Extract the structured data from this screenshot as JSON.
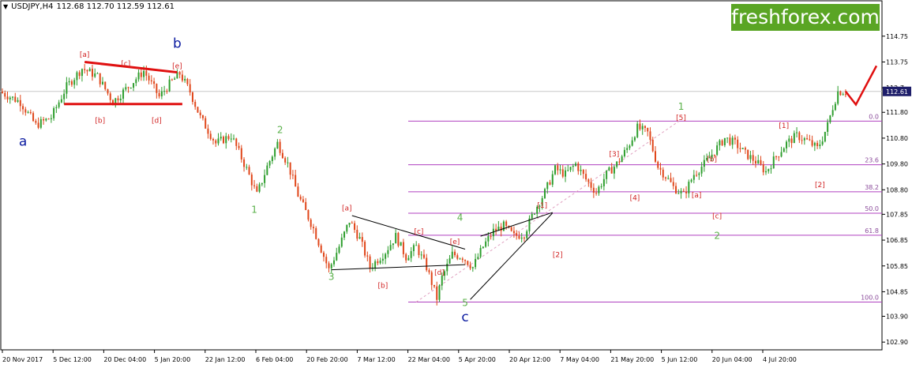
{
  "header": {
    "symbol_timeframe": "USDJPY,H4",
    "ohlc": "112.68 112.70 112.59 112.61",
    "menu_icon": "triangle-down-icon"
  },
  "logo": {
    "text": "freshforex.com",
    "bg_color": "#5aa524"
  },
  "chart_data": {
    "type": "candlestick",
    "symbol": "USDJPY",
    "timeframe": "H4",
    "current_price": 112.61,
    "ylim": [
      102.6,
      115.6
    ],
    "y_ticks": [
      114.75,
      113.75,
      112.75,
      111.8,
      110.8,
      109.8,
      108.8,
      107.85,
      106.85,
      105.85,
      104.85,
      103.9,
      102.9
    ],
    "y_tick_labels": [
      "114.75",
      "113.75",
      "112.7",
      "111.80",
      "110.80",
      "109.80",
      "108.80",
      "107.85",
      "106.85",
      "105.85",
      "104.85",
      "103.90",
      "102.90"
    ],
    "price_label": "112.61",
    "x_tick_labels": [
      "20 Nov 2017",
      "5 Dec 12:00",
      "20 Dec 04:00",
      "5 Jan 20:00",
      "22 Jan 12:00",
      "6 Feb 04:00",
      "20 Feb 20:00",
      "7 Mar 12:00",
      "22 Mar 04:00",
      "5 Apr 20:00",
      "20 Apr 12:00",
      "7 May 04:00",
      "21 May 20:00",
      "5 Jun 12:00",
      "20 Jun 04:00",
      "4 Jul 20:00"
    ],
    "bull_color": "#2e9e2e",
    "bear_color": "#e0461a",
    "price_path": [
      [
        0,
        112.6
      ],
      [
        4,
        112.2
      ],
      [
        7,
        111.3
      ],
      [
        10,
        111.6
      ],
      [
        13,
        112.8
      ],
      [
        16,
        113.5
      ],
      [
        19,
        113.2
      ],
      [
        22,
        112.2
      ],
      [
        25,
        112.8
      ],
      [
        28,
        113.4
      ],
      [
        31,
        112.4
      ],
      [
        33,
        112.9
      ],
      [
        35,
        113.3
      ],
      [
        37,
        112.6
      ],
      [
        39,
        111.6
      ],
      [
        42,
        110.6
      ],
      [
        45,
        110.9
      ],
      [
        48,
        109.6
      ],
      [
        50,
        108.6
      ],
      [
        52,
        109.7
      ],
      [
        54,
        110.6
      ],
      [
        56,
        109.8
      ],
      [
        58,
        108.6
      ],
      [
        61,
        107.3
      ],
      [
        64,
        105.7
      ],
      [
        66,
        106.6
      ],
      [
        68,
        107.6
      ],
      [
        70,
        106.9
      ],
      [
        72,
        105.8
      ],
      [
        75,
        106.4
      ],
      [
        77,
        107.0
      ],
      [
        79,
        106.2
      ],
      [
        81,
        106.6
      ],
      [
        83,
        105.8
      ],
      [
        84,
        105.2
      ],
      [
        85,
        104.6
      ],
      [
        86,
        105.4
      ],
      [
        88,
        106.3
      ],
      [
        90,
        106.2
      ],
      [
        92,
        105.8
      ],
      [
        94,
        106.6
      ],
      [
        96,
        107.2
      ],
      [
        98,
        107.4
      ],
      [
        100,
        107.0
      ],
      [
        102,
        107.1
      ],
      [
        104,
        108.0
      ],
      [
        106,
        108.7
      ],
      [
        108,
        109.6
      ],
      [
        110,
        109.4
      ],
      [
        112,
        109.8
      ],
      [
        114,
        109.2
      ],
      [
        116,
        108.7
      ],
      [
        118,
        109.4
      ],
      [
        120,
        109.8
      ],
      [
        122,
        110.4
      ],
      [
        124,
        111.2
      ],
      [
        126,
        111.0
      ],
      [
        128,
        109.7
      ],
      [
        130,
        109.2
      ],
      [
        131,
        108.9
      ],
      [
        133,
        108.6
      ],
      [
        135,
        109.4
      ],
      [
        137,
        109.8
      ],
      [
        139,
        110.3
      ],
      [
        141,
        110.8
      ],
      [
        143,
        110.6
      ],
      [
        145,
        110.2
      ],
      [
        147,
        109.9
      ],
      [
        149,
        109.5
      ],
      [
        151,
        110.1
      ],
      [
        153,
        110.6
      ],
      [
        155,
        110.9
      ],
      [
        157,
        110.7
      ],
      [
        159,
        110.4
      ],
      [
        160,
        110.8
      ],
      [
        161,
        111.3
      ],
      [
        162,
        112.0
      ],
      [
        163,
        112.6
      ],
      [
        164,
        112.61
      ]
    ],
    "fib_levels": [
      {
        "label": "0.0",
        "price": 111.46
      },
      {
        "label": "23.6",
        "price": 109.77
      },
      {
        "label": "38.2",
        "price": 108.72
      },
      {
        "label": "50.0",
        "price": 107.89
      },
      {
        "label": "61.8",
        "price": 107.04
      },
      {
        "label": "100.0",
        "price": 104.45
      }
    ],
    "fib_color": "#b040c0",
    "forecast_color": "#e01010",
    "forecast": [
      [
        164,
        112.61
      ],
      [
        166,
        112.1
      ],
      [
        170,
        113.6
      ]
    ],
    "wave_labels_blue": [
      "a",
      "b",
      "c"
    ],
    "wave_labels_green": [
      "1",
      "2",
      "3",
      "4",
      "5",
      "1",
      "2"
    ],
    "wave_labels_red": [
      "[a]",
      "[b]",
      "[c]",
      "[d]",
      "[e]",
      "[a]",
      "[b]",
      "[c]",
      "[d]",
      "[e]",
      "[1]",
      "[2]",
      "[3]",
      "[4]",
      "[5]",
      "[a]",
      "[b]",
      "[c]",
      "[1]",
      "[2]"
    ]
  }
}
